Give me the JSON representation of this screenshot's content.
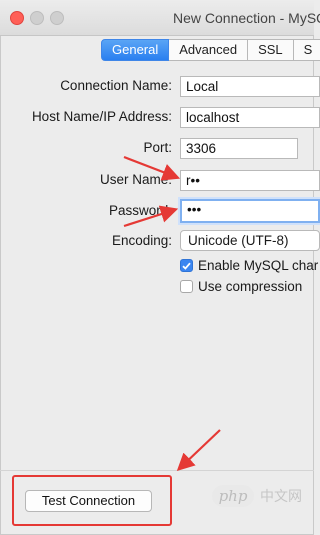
{
  "window": {
    "title": "New Connection - MySQL"
  },
  "tabs": [
    {
      "label": "General",
      "active": true
    },
    {
      "label": "Advanced",
      "active": false
    },
    {
      "label": "SSL",
      "active": false
    },
    {
      "label": "S",
      "active": false
    }
  ],
  "form": {
    "connection_name": {
      "label": "Connection Name:",
      "value": "Local"
    },
    "host": {
      "label": "Host Name/IP Address:",
      "value": "localhost"
    },
    "port": {
      "label": "Port:",
      "value": "3306"
    },
    "user_name": {
      "label": "User Name:",
      "value": "r••"
    },
    "password": {
      "label": "Password:",
      "value": "•••"
    },
    "encoding": {
      "label": "Encoding:",
      "value": "Unicode (UTF-8)"
    },
    "enable_mysql_charset": {
      "label": "Enable MySQL char",
      "checked": true
    },
    "use_compression": {
      "label": "Use compression",
      "checked": false
    }
  },
  "footer": {
    "test_connection_label": "Test Connection"
  },
  "watermark": {
    "logo_text": "php",
    "text": "中文网"
  },
  "colors": {
    "accent": "#2a7ff0",
    "annotation": "#e53935"
  }
}
